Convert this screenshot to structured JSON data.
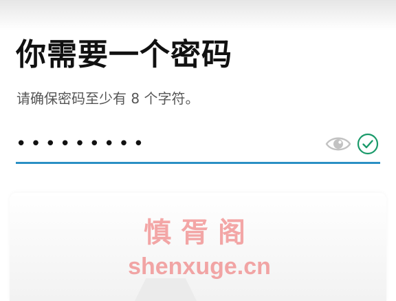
{
  "screen": {
    "title": "你需要一个密码",
    "subtitle": "请确保密码至少有 8 个字符。"
  },
  "password_field": {
    "masked_value": "•••••••••",
    "show_password_icon": "eye-icon",
    "valid_icon": "checkmark-circle-icon",
    "underline_color": "#2a8fc4",
    "valid_color": "#1a9a6a"
  },
  "watermark": {
    "name": "慎胥阁",
    "url": "shenxuge.cn"
  }
}
